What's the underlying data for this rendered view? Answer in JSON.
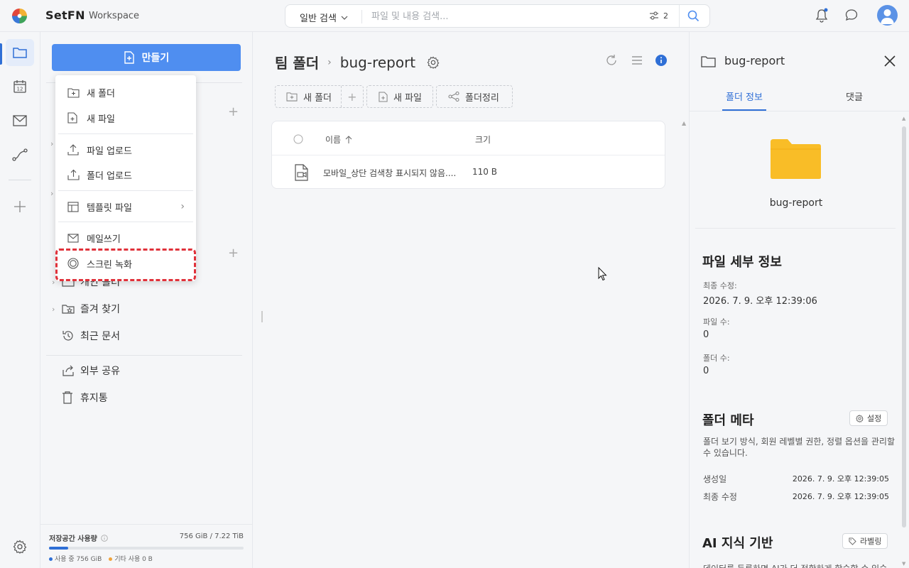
{
  "header": {
    "brand": "SetFN",
    "brand_sub": "Workspace",
    "search_mode": "일반 검색",
    "search_placeholder": "파일 및 내용 검색...",
    "filter_count": "2"
  },
  "sidebar": {
    "create_label": "만들기",
    "items": [
      {
        "label": "개인 폴더"
      },
      {
        "label": "즐겨 찾기"
      },
      {
        "label": "최근 문서"
      },
      {
        "label": "외부 공유"
      },
      {
        "label": "휴지통"
      }
    ],
    "storage": {
      "title": "저장공간 사용량",
      "value": "756 GiB / 7.22 TiB",
      "used_label": "사용 중 756 GiB",
      "other_label": "기타 사용 0 B",
      "used_fraction": 0.1
    }
  },
  "menu": {
    "items": [
      {
        "label": "새 폴더"
      },
      {
        "label": "새 파일"
      },
      {
        "label": "파일 업로드"
      },
      {
        "label": "폴더 업로드"
      },
      {
        "label": "템플릿 파일"
      },
      {
        "label": "메일쓰기"
      },
      {
        "label": "스크린 녹화"
      }
    ]
  },
  "main": {
    "breadcrumb_root": "팀 폴더",
    "breadcrumb_current": "bug-report",
    "toolbar": {
      "new_folder": "새 폴더",
      "new_file": "새 파일",
      "organize": "폴더정리"
    },
    "table": {
      "col_name": "이름",
      "col_size": "크기",
      "rows": [
        {
          "name": "모바일_상단 검색창 표시되지 않음....",
          "size": "110 B"
        }
      ]
    }
  },
  "panel": {
    "title": "bug-report",
    "tab_info": "폴더 정보",
    "tab_comments": "댓글",
    "folder_name": "bug-report",
    "details_title": "파일 세부 정보",
    "modified_label": "최종 수정:",
    "modified_value": "2026. 7. 9. 오후 12:39:06",
    "file_count_label": "파일 수:",
    "file_count_value": "0",
    "folder_count_label": "폴더 수:",
    "folder_count_value": "0",
    "meta_title": "폴더 메타",
    "meta_settings": "설정",
    "meta_desc": "폴더 보기 방식, 회원 레벨별 권한, 정렬 옵션을 관리할 수 있습니다.",
    "created_label": "생성일",
    "created_value": "2026. 7. 9. 오후 12:39:05",
    "modified2_label": "최종 수정",
    "modified2_value": "2026. 7. 9. 오후 12:39:05",
    "ai_title": "AI 지식 기반",
    "ai_label_btn": "라벨링",
    "ai_desc_cut": "데이터를 등록하면 AI가 더 정확하게 학습할 수 있습"
  },
  "colors": {
    "accent": "#2f6fd6",
    "create_button": "#4f8ef0",
    "folder": "#f9bd27",
    "highlight": "#e0313a"
  }
}
